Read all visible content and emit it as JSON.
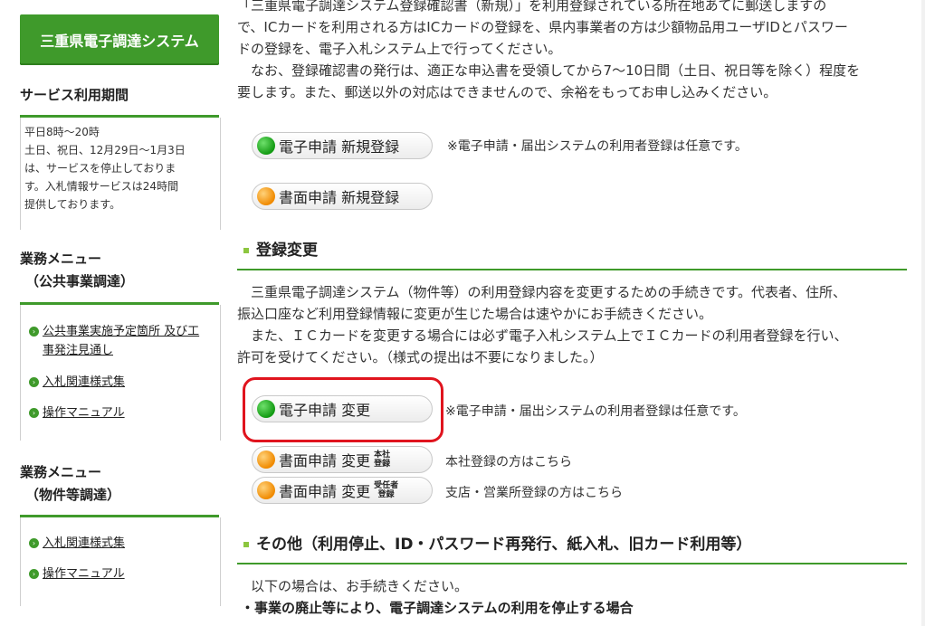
{
  "sidebar": {
    "brand": "三重県電子調達システム",
    "service_heading": "サービス利用期間",
    "hours": [
      "平日8時～20時",
      "土日、祝日、12月29日～1月3日",
      "は、サービスを停止しておりま",
      "す。入札情報サービスは24時間",
      "提供しております。"
    ],
    "menu_public": {
      "heading_line1": "業務メニュー",
      "heading_line2": "（公共事業調達）",
      "items": [
        {
          "line1": "公共事業実施予定箇所 及び工",
          "line2": "事発注見通し"
        },
        {
          "line1": "入札関連様式集"
        },
        {
          "line1": "操作マニュアル"
        }
      ]
    },
    "menu_goods": {
      "heading_line1": "業務メニュー",
      "heading_line2": "（物件等調達）",
      "items": [
        {
          "line1": "入札関連様式集"
        },
        {
          "line1": "操作マニュアル"
        }
      ]
    }
  },
  "main": {
    "intro_lines": [
      "「三重県電子調達システム登録確認書（新規）」を利用登録されている所在地あてに郵送しますの",
      "で、ICカードを利用される方はICカードの登録を、県内事業者の方は少額物品用ユーザIDとパスワー",
      "ドの登録を、電子入札システム上で行ってください。",
      "　なお、登録確認書の発行は、適正な申込書を受領してから7～10日間（土日、祝日等を除く）程度を",
      "要します。また、郵送以外の対応はできませんので、余裕をもってお申し込みください。"
    ],
    "new_registration": {
      "electronic_label": "電子申請 新規登録",
      "paper_label": "書面申請 新規登録",
      "note": "※電子申請・届出システムの利用者登録は任意です。"
    },
    "change_section": {
      "title": "登録変更",
      "body_lines": [
        "　三重県電子調達システム（物件等）の利用登録内容を変更するための手続きです。代表者、住所、",
        "振込口座など利用登録情報に変更が生じた場合は速やかにお手続きください。",
        "　また、ＩＣカードを変更する場合には必ず電子入札システム上でＩＣカードの利用者登録を行い、",
        "許可を受けてください。（様式の提出は不要になりました。）"
      ],
      "electronic_label": "電子申請 変更",
      "electronic_note": "※電子申請・届出システムの利用者登録は任意です。",
      "paper_hq_label": "書面申請 変更",
      "paper_hq_tag_line1": "本社",
      "paper_hq_tag_line2": "登録",
      "paper_hq_note": "本社登録の方はこちら",
      "paper_branch_label": "書面申請 変更",
      "paper_branch_tag_line1": "受任者",
      "paper_branch_tag_line2": "登録",
      "paper_branch_note": "支店・営業所登録の方はこちら"
    },
    "other_section": {
      "title": "その他（利用停止、ID・パスワード再発行、紙入札、旧カード利用等）",
      "body": "　以下の場合は、お手続きください。",
      "bullet1": "・事業の廃止等により、電子調達システムの利用を停止する場合"
    }
  },
  "colors": {
    "brand_green": "#3f9a2b",
    "highlight_red": "#e0141e",
    "button_green": "#139a13",
    "button_orange": "#f08a00"
  }
}
